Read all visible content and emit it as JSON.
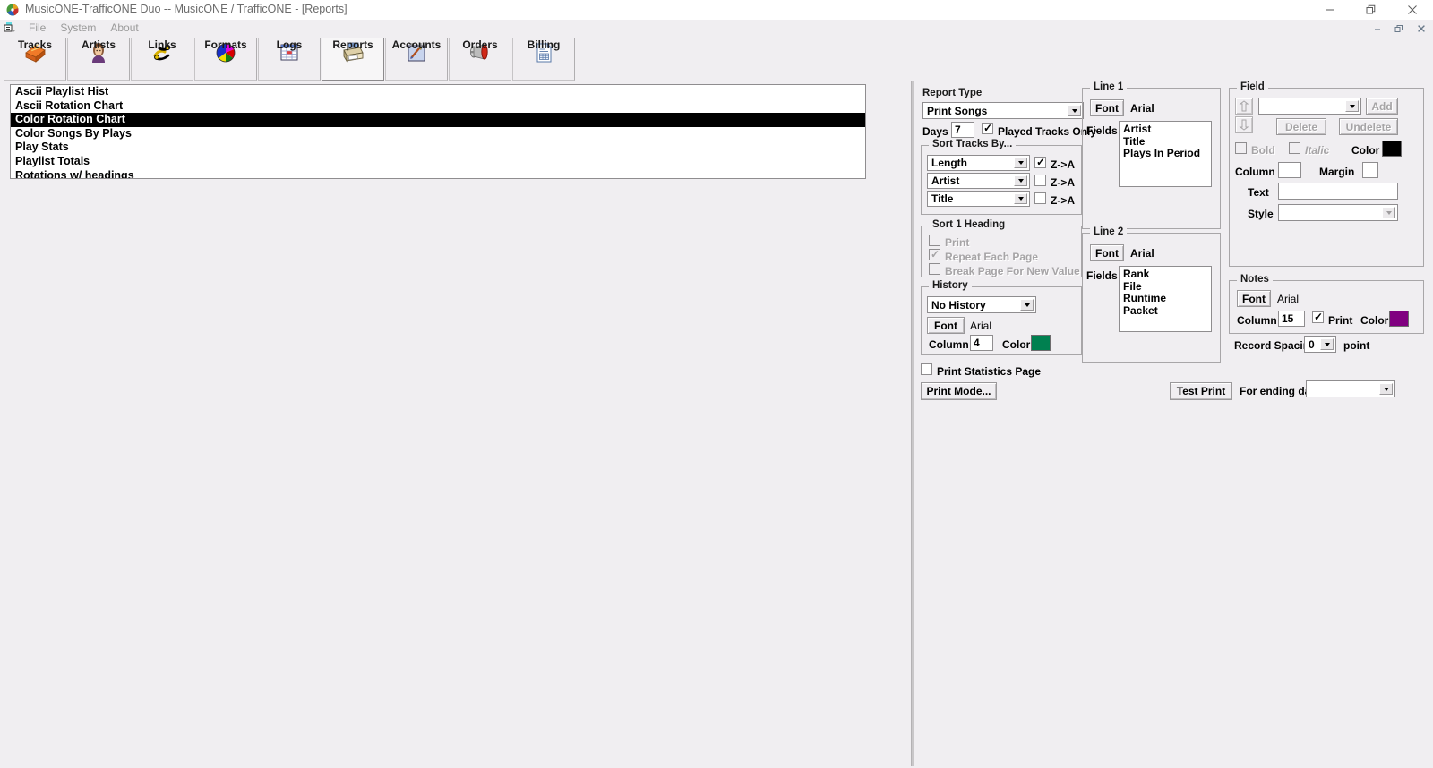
{
  "window": {
    "title": "MusicONE-TrafficONE Duo -- MusicONE / TrafficONE - [Reports]",
    "minimize": "─",
    "restore": "❐",
    "close": "✕",
    "child_minimize": "–",
    "child_restore": "❐",
    "child_close": "✕"
  },
  "menu": {
    "items": [
      "File",
      "System",
      "About"
    ]
  },
  "toolbar": {
    "buttons": [
      {
        "label": "Tracks",
        "icon": "tracks-icon",
        "selected": false
      },
      {
        "label": "Artists",
        "icon": "artists-icon",
        "selected": false
      },
      {
        "label": "Links",
        "icon": "links-icon",
        "selected": false
      },
      {
        "label": "Formats",
        "icon": "formats-icon",
        "selected": false
      },
      {
        "label": "Logs",
        "icon": "logs-icon",
        "selected": false
      },
      {
        "label": "Reports",
        "icon": "reports-icon",
        "selected": true
      },
      {
        "label": "Accounts",
        "icon": "accounts-icon",
        "selected": false
      },
      {
        "label": "Orders",
        "icon": "orders-icon",
        "selected": false
      },
      {
        "label": "Billing",
        "icon": "billing-icon",
        "selected": false
      }
    ]
  },
  "report_list": {
    "items": [
      {
        "label": "Ascii Playlist Hist",
        "selected": false
      },
      {
        "label": "Ascii Rotation Chart",
        "selected": false
      },
      {
        "label": "Color Rotation Chart",
        "selected": true
      },
      {
        "label": "Color Songs By Plays",
        "selected": false
      },
      {
        "label": "Play Stats",
        "selected": false
      },
      {
        "label": "Playlist Totals",
        "selected": false
      },
      {
        "label": "Rotations w/ headings",
        "selected": false
      }
    ]
  },
  "report_type": {
    "caption": "Report Type",
    "value": "Print Songs",
    "days_label": "Days",
    "days_value": "7",
    "played_tracks_only_label": "Played Tracks Only",
    "played_tracks_only_checked": true
  },
  "sort_tracks": {
    "caption": "Sort Tracks By...",
    "rows": [
      {
        "value": "Length",
        "za_label": "Z->A",
        "za_checked": true
      },
      {
        "value": "Artist",
        "za_label": "Z->A",
        "za_checked": false
      },
      {
        "value": "Title",
        "za_label": "Z->A",
        "za_checked": false
      }
    ]
  },
  "sort1_heading": {
    "caption": "Sort 1 Heading",
    "options": [
      {
        "label": "Print",
        "checked": false
      },
      {
        "label": "Repeat Each Page",
        "checked": true
      },
      {
        "label": "Break Page For New Value",
        "checked": false
      }
    ]
  },
  "history": {
    "caption": "History",
    "value": "No History",
    "font_button": "Font",
    "font_name": "Arial",
    "column_label": "Column",
    "column_value": "4",
    "color_label": "Color",
    "color": "#008050"
  },
  "print_statistics": {
    "label": "Print Statistics Page",
    "checked": false
  },
  "print_mode_button": "Print  Mode...",
  "line1": {
    "caption": "Line 1",
    "font_button": "Font",
    "font_name": "Arial",
    "fields_label": "Fields",
    "fields": [
      "Artist",
      "Title",
      "Plays In Period"
    ]
  },
  "line2": {
    "caption": "Line 2",
    "font_button": "Font",
    "font_name": "Arial",
    "fields_label": "Fields",
    "fields": [
      "Rank",
      "File",
      "Runtime",
      "Packet"
    ]
  },
  "field": {
    "caption": "Field",
    "select_value": "",
    "add_button": "Add",
    "delete_button": "Delete",
    "undelete_button": "Undelete",
    "bold_label": "Bold",
    "bold_checked": false,
    "italic_label": "Italic",
    "italic_checked": false,
    "color_label": "Color",
    "color": "#000000",
    "column_label": "Column",
    "column_value": "",
    "margin_label": "Margin",
    "margin_value": "",
    "text_label": "Text",
    "text_value": "",
    "style_label": "Style",
    "style_value": "",
    "move_up_icon": "move-up-icon",
    "move_down_icon": "move-down-icon"
  },
  "notes": {
    "caption": "Notes",
    "font_button": "Font",
    "font_name": "Arial",
    "column_label": "Column",
    "column_value": "15",
    "print_label": "Print",
    "print_checked": true,
    "color_label": "Color",
    "color": "#800080"
  },
  "record_spacing": {
    "label": "Record Spacing",
    "value": "0",
    "unit": "point"
  },
  "test_print_button": "Test Print",
  "for_ending_day": {
    "label": "For ending day",
    "value": ""
  }
}
